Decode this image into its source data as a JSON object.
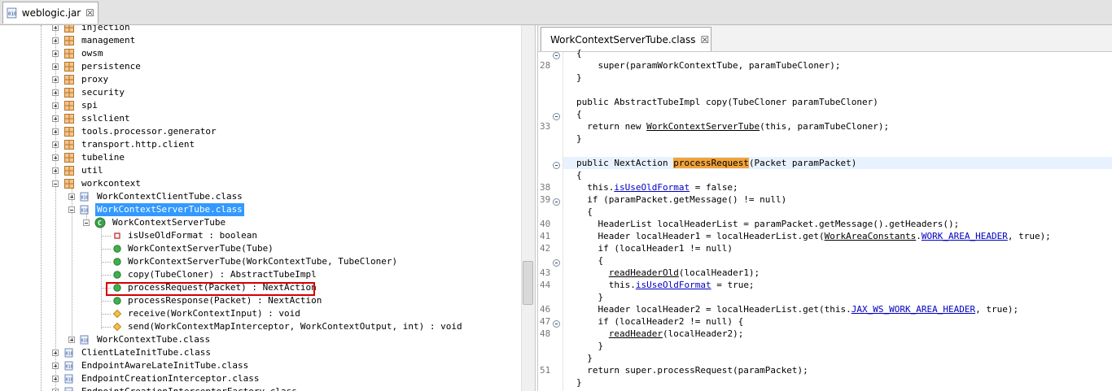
{
  "top_tab": {
    "title": "weblogic.jar",
    "close": "☒"
  },
  "tree": {
    "packages": [
      "injection",
      "management",
      "owsm",
      "persistence",
      "proxy",
      "security",
      "spi",
      "sslclient",
      "tools.processor.generator",
      "transport.http.client",
      "tubeline",
      "util",
      "workcontext"
    ],
    "workcontext_children": {
      "client_tube": "WorkContextClientTube.class",
      "server_tube": "WorkContextServerTube.class",
      "server_class": "WorkContextServerTube",
      "members": [
        "isUseOldFormat : boolean",
        "WorkContextServerTube(Tube)",
        "WorkContextServerTube(WorkContextTube, TubeCloner)",
        "copy(TubeCloner) : AbstractTubeImpl",
        "processRequest(Packet) : NextAction",
        "processResponse(Packet) : NextAction",
        "receive(WorkContextInput) : void",
        "send(WorkContextMapInterceptor, WorkContextOutput, int) : void"
      ],
      "tube": "WorkContextTube.class"
    },
    "siblings": [
      "ClientLateInitTube.class",
      "EndpointAwareLateInitTube.class",
      "EndpointCreationInterceptor.class",
      "EndpointCreationInterceptorFactory.class"
    ]
  },
  "editor": {
    "tab_title": "WorkContextServerTube.class",
    "tab_close": "☒",
    "line_numbers": {
      "l28": "28",
      "l33": "33",
      "l38": "38",
      "l39": "39",
      "l40": "40",
      "l41": "41",
      "l42": "42",
      "l43": "43",
      "l44": "44",
      "l46": "46",
      "l47": "47",
      "l48": "48",
      "l51": "51"
    },
    "code": {
      "c00": "{",
      "c01_pre": "  super(paramWorkContextTube, paramTubeCloner);",
      "c02": "}",
      "c04": "public AbstractTubeImpl copy(TubeCloner paramTubeCloner)",
      "c05": "{",
      "c06_a": "  return new ",
      "c06_b": "WorkContextServerTube",
      "c06_c": "(this, paramTubeCloner);",
      "c07": "}",
      "c09_a": "public NextAction ",
      "c09_b": "processRequest",
      "c09_c": "(Packet paramPacket)",
      "c10": "{",
      "c11_a": "  this.",
      "c11_b": "isUseOldFormat",
      "c11_c": " = false;",
      "c12": "  if (paramPacket.getMessage() != null)",
      "c13": "  {",
      "c14": "    HeaderList localHeaderList = paramPacket.getMessage().getHeaders();",
      "c15_a": "    Header localHeader1 = localHeaderList.get(",
      "c15_b": "WorkAreaConstants",
      "c15_c": ".",
      "c15_d": "WORK_AREA_HEADER",
      "c15_e": ", true);",
      "c16": "    if (localHeader1 != null)",
      "c17": "    {",
      "c18_a": "      ",
      "c18_b": "readHeaderOld",
      "c18_c": "(localHeader1);",
      "c19_a": "      this.",
      "c19_b": "isUseOldFormat",
      "c19_c": " = true;",
      "c20": "    }",
      "c21_a": "    Header localHeader2 = localHeaderList.get(this.",
      "c21_b": "JAX_WS_WORK_AREA_HEADER",
      "c21_c": ", true);",
      "c22": "    if (localHeader2 != null) {",
      "c23_a": "      ",
      "c23_b": "readHeader",
      "c23_c": "(localHeader2);",
      "c24": "    }",
      "c25": "  }",
      "c26": "  return super.processRequest(paramPacket);",
      "c27": "}"
    }
  },
  "colors": {
    "selection": "#3399ff",
    "highlight": "#f1a43a",
    "keyword": "#7f0055",
    "field": "#0000c0",
    "redbox": "#d40000"
  }
}
